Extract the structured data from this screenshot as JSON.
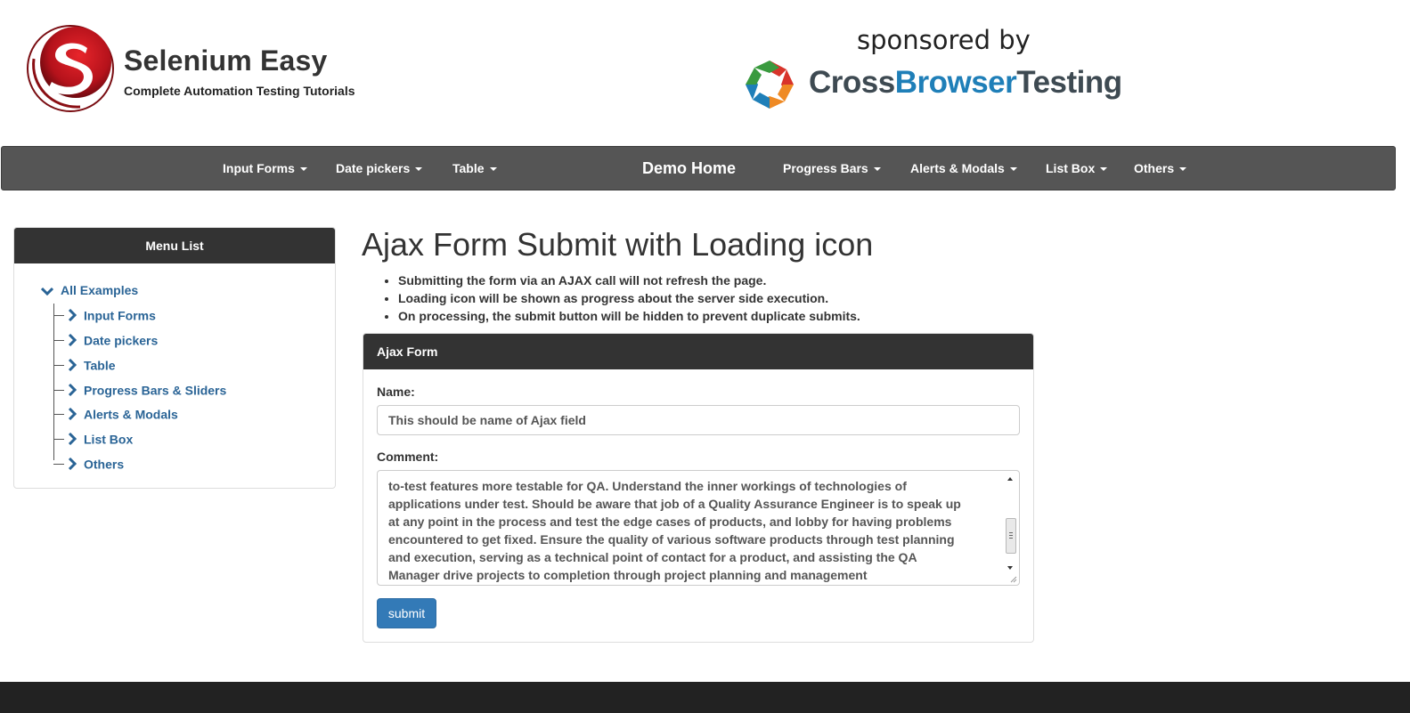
{
  "brand": {
    "title": "Selenium Easy",
    "subtitle": "Complete Automation Testing Tutorials"
  },
  "sponsor": {
    "label": "sponsored by",
    "name_part1": "Cross",
    "name_part2": "Browser",
    "name_part3": "Testing"
  },
  "navbar": {
    "items": [
      {
        "label": "Input Forms"
      },
      {
        "label": "Date pickers"
      },
      {
        "label": "Table"
      },
      {
        "label": "Demo Home"
      },
      {
        "label": "Progress Bars"
      },
      {
        "label": "Alerts & Modals"
      },
      {
        "label": "List Box"
      },
      {
        "label": "Others"
      }
    ]
  },
  "sidebar": {
    "heading": "Menu List",
    "root": "All Examples",
    "items": [
      {
        "label": "Input Forms"
      },
      {
        "label": "Date pickers"
      },
      {
        "label": "Table"
      },
      {
        "label": "Progress Bars & Sliders"
      },
      {
        "label": "Alerts & Modals"
      },
      {
        "label": "List Box"
      },
      {
        "label": "Others"
      }
    ]
  },
  "main": {
    "title": "Ajax Form Submit with Loading icon",
    "bullets": [
      "Submitting the form via an AJAX call will not refresh the page.",
      "Loading icon will be shown as progress about the server side execution.",
      "On processing, the submit button will be hidden to prevent duplicate submits."
    ]
  },
  "form": {
    "panel_title": "Ajax Form",
    "name_label": "Name:",
    "name_value": "This should be name of Ajax field",
    "comment_label": "Comment:",
    "comment_text": "to-test features more testable for QA. Understand the inner workings of technologies of\napplications under test. Should be aware that job of a Quality Assurance Engineer is to speak up\nat any point in the process and test the edge cases of products, and lobby for having problems\nencountered to get fixed. Ensure the quality of various software products through test planning\nand execution, serving as a technical point of contact for a product, and assisting the QA\nManager drive projects to completion through project planning and management",
    "submit_label": "submit"
  },
  "colors": {
    "navbar_bg": "#555555",
    "panel_header_bg": "#333333",
    "link": "#2a6496",
    "primary_button": "#337ab7",
    "logo_red": "#c0161b",
    "footer_bg": "#222222"
  },
  "icons": {
    "brand_logo": "selenium-easy-logo",
    "sponsor_logo": "crossbrowsertesting-logo",
    "nav_caret": "caret-down-icon",
    "tree_root": "chevron-down-icon",
    "tree_item": "chevron-right-icon"
  }
}
